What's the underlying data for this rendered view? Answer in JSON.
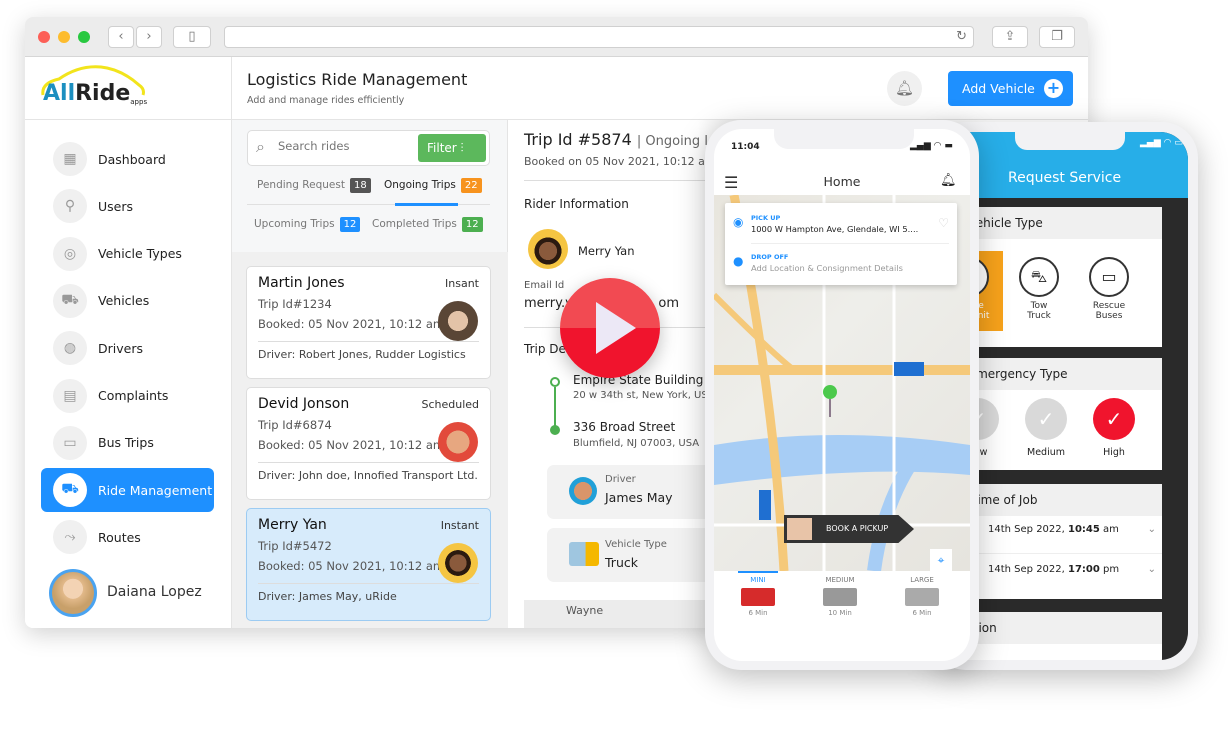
{
  "browser": {
    "back": "‹",
    "forward": "›"
  },
  "logo": {
    "text_a": "All",
    "text_b": "Ride",
    "sub": "apps"
  },
  "sidebar": {
    "items": [
      {
        "label": "Dashboard",
        "icon": "grid-icon"
      },
      {
        "label": "Users",
        "icon": "user-icon"
      },
      {
        "label": "Vehicle Types",
        "icon": "fingerprint-icon"
      },
      {
        "label": "Vehicles",
        "icon": "car-icon"
      },
      {
        "label": "Drivers",
        "icon": "steering-wheel-icon"
      },
      {
        "label": "Complaints",
        "icon": "complaints-icon"
      },
      {
        "label": "Bus Trips",
        "icon": "bus-icon"
      },
      {
        "label": "Ride Management",
        "icon": "truck-icon",
        "active": true
      },
      {
        "label": "Routes",
        "icon": "route-icon"
      }
    ],
    "user": "Daiana Lopez"
  },
  "header": {
    "title": "Logistics Ride Management",
    "subtitle": "Add and manage rides efficiently",
    "add_button": "Add Vehicle"
  },
  "list": {
    "search_placeholder": "Search rides",
    "filter": "Filter",
    "tabs": [
      {
        "label": "Pending Request",
        "count": "18",
        "color": "#555555"
      },
      {
        "label": "Ongoing Trips",
        "count": "22",
        "color": "#f7931e",
        "active": true
      },
      {
        "label": "Upcoming Trips",
        "count": "12",
        "color": "#1e90ff"
      },
      {
        "label": "Completed Trips",
        "count": "12",
        "color": "#4caf50"
      }
    ],
    "cards": [
      {
        "name": "Martin Jones",
        "type": "Insant",
        "trip": "Trip Id#1234",
        "booked": "Booked: 05 Nov 2021, 10:12 am",
        "driver": "Driver: Robert Jones, Rudder Logistics"
      },
      {
        "name": "Devid Jonson",
        "type": "Scheduled",
        "trip": "Trip Id#6874",
        "booked": "Booked: 05 Nov 2021, 10:12 am",
        "driver": "Driver: John doe, Innofied Transport Ltd."
      },
      {
        "name": "Merry Yan",
        "type": "Instant",
        "trip": "Trip Id#5472",
        "booked": "Booked: 05 Nov 2021, 10:12 am",
        "driver": "Driver: James May, uRide",
        "selected": true
      }
    ]
  },
  "detail": {
    "trip_id": "Trip Id #5874",
    "status": "Ongoing I",
    "booked": "Booked on 05 Nov 2021, 10:12 am",
    "rider_heading": "Rider Information",
    "rider_name": "Merry Yan",
    "email_label": "Email Id",
    "email_a": "merry.y",
    "email_b": "om",
    "trip_heading": "Trip De",
    "from_title": "Empire State Building",
    "from_addr": "20 w 34th st, New York, US.",
    "to_title": "336 Broad Street",
    "to_addr": "Blumfield, NJ 07003, USA",
    "driver_label": "Driver",
    "driver_name": "James May",
    "vehicle_label": "Vehicle Type",
    "vehicle_name": "Truck",
    "map_label": "Wayne"
  },
  "phone1": {
    "time": "11:04",
    "title": "Home",
    "pickup_label": "PICK UP",
    "pickup": "1000 W Hampton Ave, Glendale, WI 5....",
    "dropoff_label": "DROP OFF",
    "dropoff": "Add Location & Consignment Details",
    "book": "BOOK A PICKUP",
    "vehicles": [
      {
        "label": "MINI",
        "eta": "6 Min",
        "active": true
      },
      {
        "label": "MEDIUM",
        "eta": "10 Min"
      },
      {
        "label": "LARGE",
        "eta": "6 Min"
      }
    ]
  },
  "phone2": {
    "title": "Request Service",
    "vehicle_heading": "ect Vehicle Type",
    "vehicle_types": [
      {
        "label": "Mobile\natch Unit",
        "selected": true
      },
      {
        "label": "Tow\nTruck"
      },
      {
        "label": "Rescue\nBuses"
      }
    ],
    "emergency_heading": "ect Emergency Type",
    "emergency": [
      {
        "label": "Low"
      },
      {
        "label": "Medium"
      },
      {
        "label": "High",
        "selected": true
      }
    ],
    "time_heading": "e & Time of Job",
    "times": [
      {
        "label": "s At",
        "sep": ":",
        "date": "14th Sep 2022, ",
        "time": "10:45",
        "ampm": " am"
      },
      {
        "label": "s At",
        "sep": ":",
        "date": "14th Sep 2022, ",
        "time": "17:00",
        "ampm": " pm"
      }
    ],
    "location_heading": "Location"
  },
  "colors": {
    "accent": "#1e90ff",
    "green": "#5cb85c",
    "red": "#f0142d",
    "orange": "#f7a21b",
    "sky": "#27aee8"
  }
}
